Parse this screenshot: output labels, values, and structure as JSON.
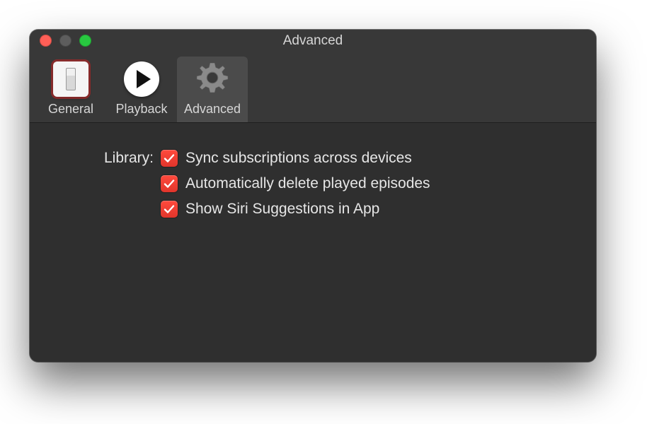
{
  "window": {
    "title": "Advanced"
  },
  "tabs": {
    "general": "General",
    "playback": "Playback",
    "advanced": "Advanced",
    "selected": "advanced"
  },
  "section": {
    "label": "Library:"
  },
  "options": {
    "sync": {
      "label": "Sync subscriptions across devices",
      "checked": true
    },
    "delete": {
      "label": "Automatically delete played episodes",
      "checked": true
    },
    "siri": {
      "label": "Show Siri Suggestions in App",
      "checked": true
    }
  }
}
